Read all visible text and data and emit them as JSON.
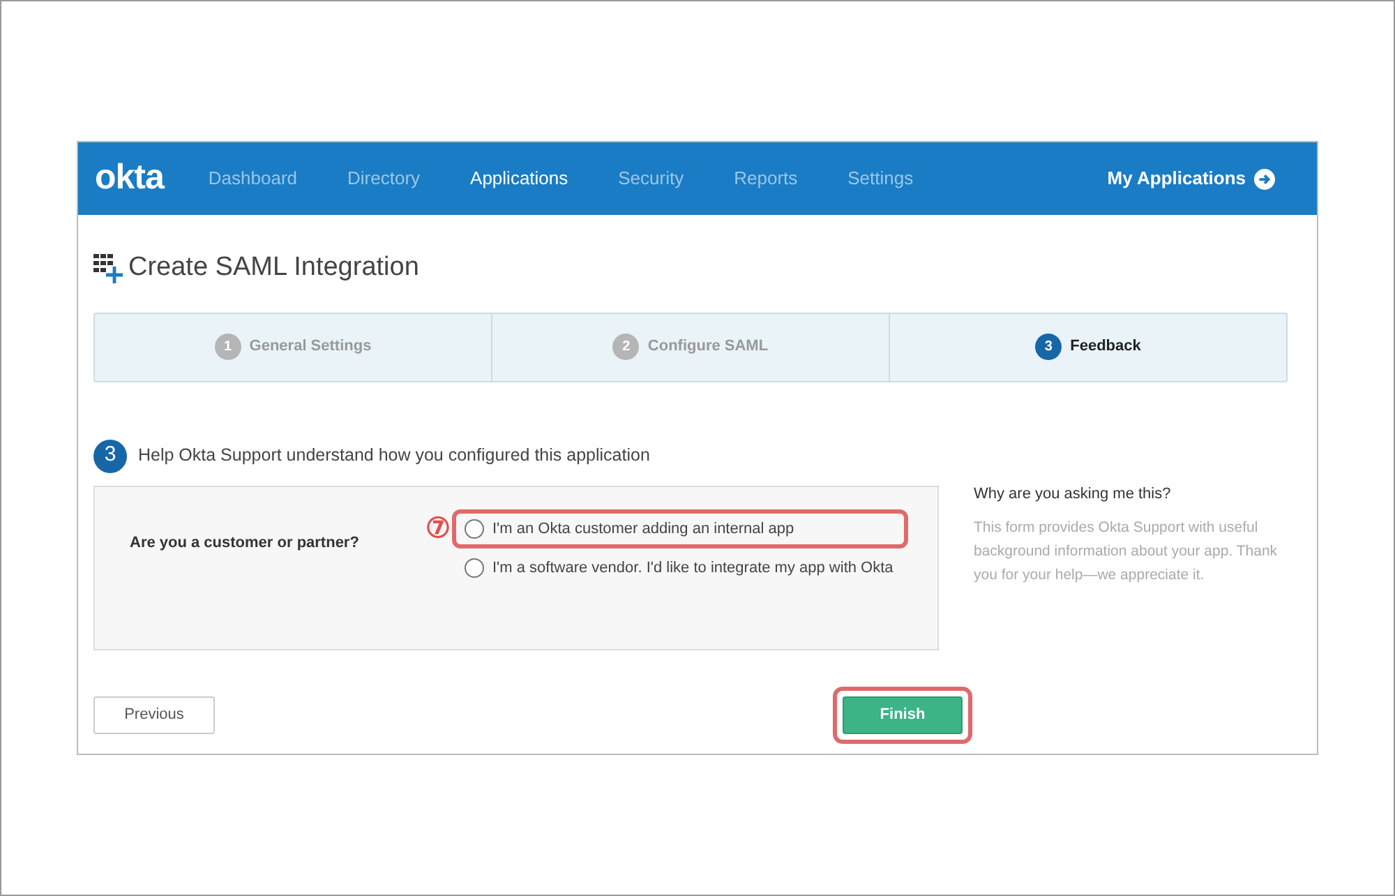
{
  "navbar": {
    "logo": "okta",
    "items": [
      {
        "label": "Dashboard",
        "selected": false
      },
      {
        "label": "Directory",
        "selected": false
      },
      {
        "label": "Applications",
        "selected": true
      },
      {
        "label": "Security",
        "selected": false
      },
      {
        "label": "Reports",
        "selected": false
      },
      {
        "label": "Settings",
        "selected": false
      }
    ],
    "my_applications": "My Applications"
  },
  "page_title": "Create SAML Integration",
  "steps": [
    {
      "number": "1",
      "label": "General Settings",
      "selected": false
    },
    {
      "number": "2",
      "label": "Configure SAML",
      "selected": false
    },
    {
      "number": "3",
      "label": "Feedback",
      "selected": true
    }
  ],
  "section": {
    "number": "3",
    "title": "Help Okta Support understand how you configured this application"
  },
  "question": {
    "label": "Are you a customer or partner?",
    "callout": "⑦",
    "options": [
      {
        "label": "I'm an Okta customer adding an internal app",
        "selected": false,
        "highlighted": true
      },
      {
        "label": "I'm a software vendor. I'd like to integrate my app with Okta",
        "selected": false,
        "highlighted": false
      }
    ]
  },
  "help": {
    "title": "Why are you asking me this?",
    "text": "This form provides Okta Support with useful background information about your app. Thank you for your help—we appreciate it."
  },
  "buttons": {
    "previous": "Previous",
    "finish": {
      "label": "Finish",
      "highlighted": true
    }
  }
}
